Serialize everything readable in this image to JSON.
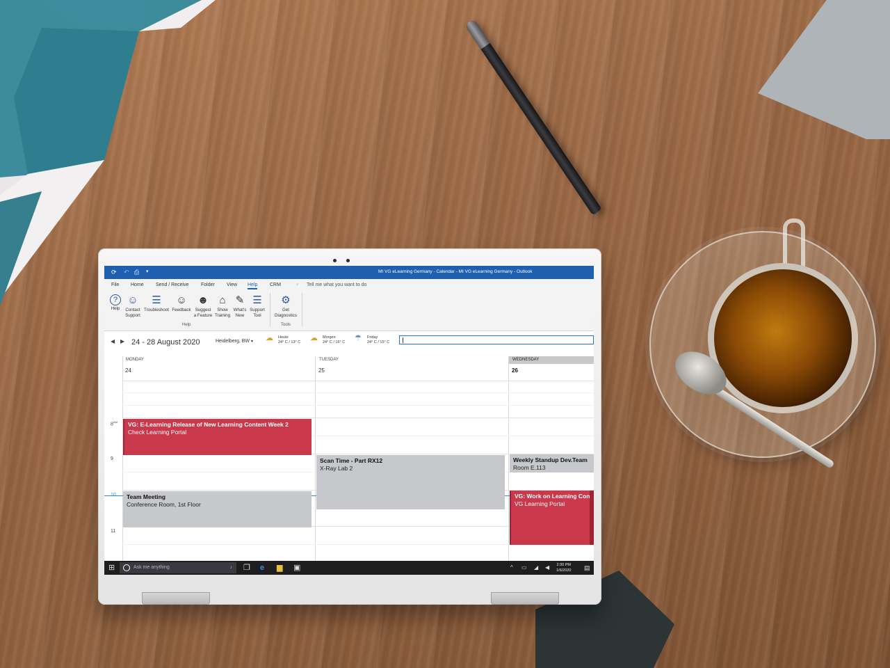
{
  "window": {
    "title": "MI VG eLearning Germany - Calendar - MI VG eLearning Germany  -  Outlook"
  },
  "quick_access": [
    "⟳",
    "↶",
    "⎙",
    "▾"
  ],
  "menu": {
    "file": "File",
    "home": "Home",
    "send_receive": "Send / Receive",
    "folder": "Folder",
    "view": "View",
    "help": "Help",
    "crm": "CRM",
    "tell_me": "Tell me what you want to do"
  },
  "ribbon": {
    "help_group_label": "Help",
    "tools_group_label": "Tools",
    "buttons": [
      {
        "icon": "help-icon",
        "glyph": "?",
        "label1": "Help",
        "label2": ""
      },
      {
        "icon": "contact-support-icon",
        "glyph": "☺",
        "label1": "Contact",
        "label2": "Support"
      },
      {
        "icon": "troubleshoot-icon",
        "glyph": "☰",
        "label1": "Troubleshoot",
        "label2": ""
      },
      {
        "icon": "feedback-icon",
        "glyph": "☺",
        "label1": "Feedback",
        "label2": ""
      },
      {
        "icon": "suggest-feature-icon",
        "glyph": "☻",
        "label1": "Suggest",
        "label2": "a Feature"
      },
      {
        "icon": "show-training-icon",
        "glyph": "⌂",
        "label1": "Show",
        "label2": "Training"
      },
      {
        "icon": "whats-new-icon",
        "glyph": "✎",
        "label1": "What's",
        "label2": "New"
      },
      {
        "icon": "support-tool-icon",
        "glyph": "☰",
        "label1": "Support",
        "label2": "Tool"
      }
    ],
    "tools_button": {
      "icon": "get-diagnostics-icon",
      "glyph": "⚙",
      "label1": "Get",
      "label2": "Diagnostics"
    }
  },
  "nav": {
    "date_range": "24 - 28 August 2020",
    "location": "Heidelberg, BW",
    "location_dropdown": "▾",
    "weather": [
      {
        "day": "Heute",
        "temp": "24° C / 13° C"
      },
      {
        "day": "Morgen",
        "temp": "24° C / 16° C"
      },
      {
        "day": "Friday",
        "temp": "24° C / 15° C"
      }
    ]
  },
  "calendar": {
    "days": [
      {
        "name": "MONDAY",
        "date": "24"
      },
      {
        "name": "TUESDAY",
        "date": "25"
      },
      {
        "name": "WEDNESDAY",
        "date": "26"
      }
    ],
    "times": [
      {
        "hour": "8",
        "suffix": "AM"
      },
      {
        "hour": "9",
        "suffix": ""
      },
      {
        "hour": "10",
        "suffix": ""
      },
      {
        "hour": "11",
        "suffix": ""
      }
    ],
    "events": [
      {
        "title": "VG: E-Learning Release of New Learning Content Week 2",
        "location": "Check Learning Portal"
      },
      {
        "title": "Team Meeting",
        "location": "Conference Room, 1st Floor"
      },
      {
        "title": "Scan Time - Part RX12",
        "location": "X-Ray Lab 2"
      },
      {
        "title": "Weekly Standup Dev.Team",
        "location": "Room E.113"
      },
      {
        "title": "VG: Work on Learning Content",
        "location": "VG Learning Portal"
      }
    ]
  },
  "taskbar": {
    "search_placeholder": "Ask me anything",
    "time": "2:30 PM",
    "date": "1/6/2020"
  }
}
